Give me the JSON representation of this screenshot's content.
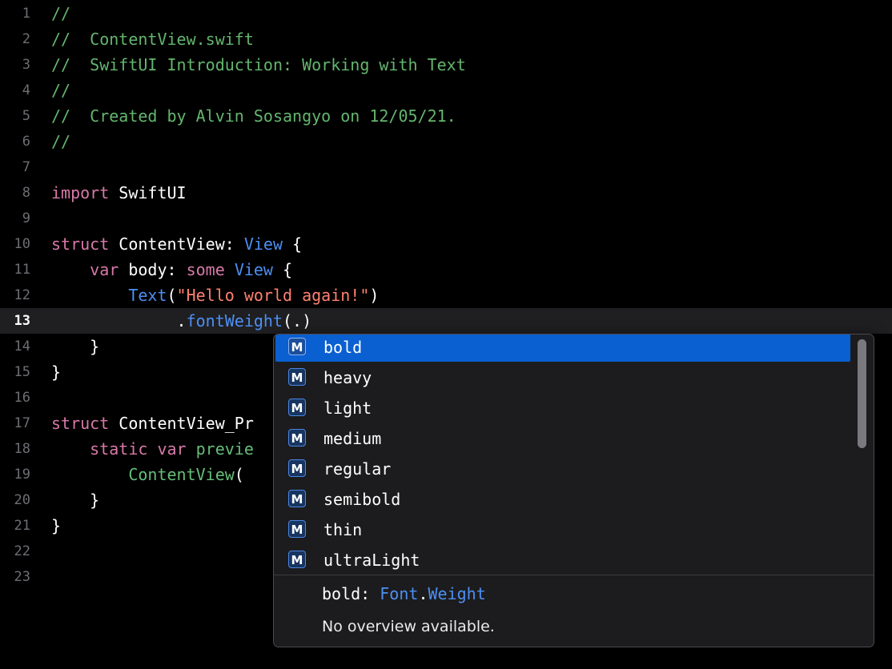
{
  "editor": {
    "current_line": 13,
    "lines": [
      {
        "n": "1",
        "tokens": [
          {
            "t": "//",
            "c": "comment"
          }
        ]
      },
      {
        "n": "2",
        "tokens": [
          {
            "t": "//  ContentView.swift",
            "c": "comment"
          }
        ]
      },
      {
        "n": "3",
        "tokens": [
          {
            "t": "//  SwiftUI Introduction: Working with Text",
            "c": "comment"
          }
        ]
      },
      {
        "n": "4",
        "tokens": [
          {
            "t": "//",
            "c": "comment"
          }
        ]
      },
      {
        "n": "5",
        "tokens": [
          {
            "t": "//  Created by Alvin Sosangyo on 12/05/21.",
            "c": "comment"
          }
        ]
      },
      {
        "n": "6",
        "tokens": [
          {
            "t": "//",
            "c": "comment"
          }
        ]
      },
      {
        "n": "7",
        "tokens": []
      },
      {
        "n": "8",
        "tokens": [
          {
            "t": "import",
            "c": "keyword"
          },
          {
            "t": " SwiftUI",
            "c": "plain"
          }
        ]
      },
      {
        "n": "9",
        "tokens": []
      },
      {
        "n": "10",
        "tokens": [
          {
            "t": "struct",
            "c": "keyword"
          },
          {
            "t": " ContentView: ",
            "c": "plain"
          },
          {
            "t": "View",
            "c": "type"
          },
          {
            "t": " {",
            "c": "plain"
          }
        ]
      },
      {
        "n": "11",
        "tokens": [
          {
            "t": "    ",
            "c": "plain"
          },
          {
            "t": "var",
            "c": "keyword"
          },
          {
            "t": " body: ",
            "c": "plain"
          },
          {
            "t": "some",
            "c": "keyword"
          },
          {
            "t": " ",
            "c": "plain"
          },
          {
            "t": "View",
            "c": "type"
          },
          {
            "t": " {",
            "c": "plain"
          }
        ]
      },
      {
        "n": "12",
        "tokens": [
          {
            "t": "        ",
            "c": "plain"
          },
          {
            "t": "Text",
            "c": "type"
          },
          {
            "t": "(",
            "c": "plain"
          },
          {
            "t": "\"Hello world again!\"",
            "c": "string"
          },
          {
            "t": ")",
            "c": "plain"
          }
        ]
      },
      {
        "n": "13",
        "tokens": [
          {
            "t": "             .",
            "c": "plain"
          },
          {
            "t": "fontWeight",
            "c": "type"
          },
          {
            "t": "(.)",
            "c": "plain"
          }
        ]
      },
      {
        "n": "14",
        "tokens": [
          {
            "t": "    }",
            "c": "plain"
          }
        ]
      },
      {
        "n": "15",
        "tokens": [
          {
            "t": "}",
            "c": "plain"
          }
        ]
      },
      {
        "n": "16",
        "tokens": []
      },
      {
        "n": "17",
        "tokens": [
          {
            "t": "struct",
            "c": "keyword"
          },
          {
            "t": " ContentView_Pr",
            "c": "plain"
          }
        ]
      },
      {
        "n": "18",
        "tokens": [
          {
            "t": "    ",
            "c": "plain"
          },
          {
            "t": "static",
            "c": "keyword"
          },
          {
            "t": " ",
            "c": "plain"
          },
          {
            "t": "var",
            "c": "keyword"
          },
          {
            "t": " ",
            "c": "plain"
          },
          {
            "t": "previe",
            "c": "func"
          }
        ]
      },
      {
        "n": "19",
        "tokens": [
          {
            "t": "        ",
            "c": "plain"
          },
          {
            "t": "ContentView",
            "c": "func"
          },
          {
            "t": "(",
            "c": "plain"
          }
        ]
      },
      {
        "n": "20",
        "tokens": [
          {
            "t": "    }",
            "c": "plain"
          }
        ]
      },
      {
        "n": "21",
        "tokens": [
          {
            "t": "}",
            "c": "plain"
          }
        ]
      },
      {
        "n": "22",
        "tokens": []
      },
      {
        "n": "23",
        "tokens": []
      }
    ]
  },
  "autocomplete": {
    "badge_letter": "M",
    "selected_index": 0,
    "items": [
      "bold",
      "heavy",
      "light",
      "medium",
      "regular",
      "semibold",
      "thin",
      "ultraLight"
    ],
    "detail": {
      "name": "bold:",
      "type_module": "Font",
      "type_dot": ".",
      "type_name": "Weight",
      "description": "No overview available."
    }
  },
  "colors": {
    "comment": "#63b56e",
    "keyword": "#d77aa9",
    "type": "#4d8ff2",
    "string": "#ff8170",
    "selection": "#0a5fd1",
    "background": "#000000"
  }
}
